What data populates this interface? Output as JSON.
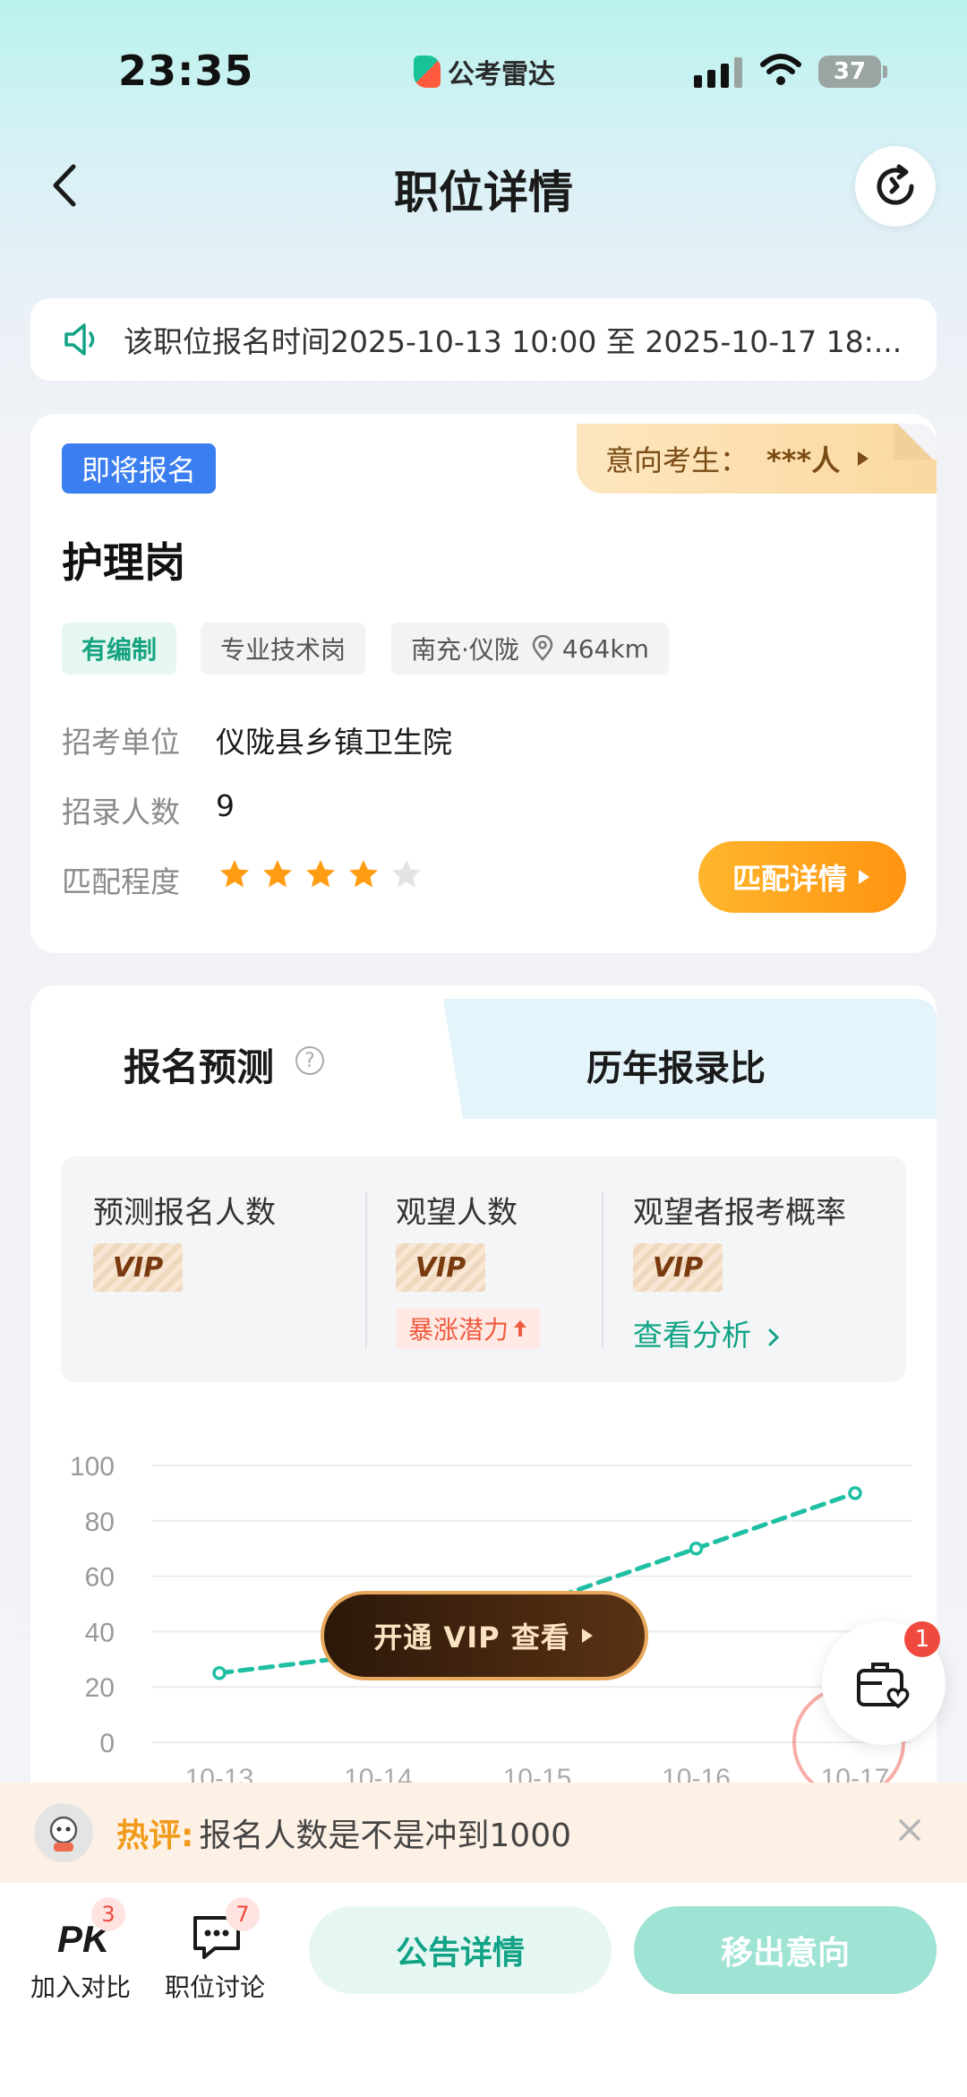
{
  "status_bar": {
    "time": "23:35",
    "app_brand": "公考雷达",
    "battery": "37"
  },
  "header": {
    "title": "职位详情"
  },
  "notice": {
    "text": "该职位报名时间2025-10-13 10:00 至 2025-10-17 18:..."
  },
  "job": {
    "status_badge": "即将报名",
    "intent_label": "意向考生：",
    "intent_value": "***人",
    "title": "护理岗",
    "tags": [
      "有编制",
      "专业技术岗"
    ],
    "location": "南充·仪陇",
    "distance": "464km",
    "fields": [
      {
        "label": "招考单位",
        "value": "仪陇县乡镇卫生院"
      },
      {
        "label": "招录人数",
        "value": "9"
      },
      {
        "label": "匹配程度",
        "value": ""
      }
    ],
    "match_stars": 4,
    "match_stars_max": 5,
    "match_button": "匹配详情"
  },
  "forecast": {
    "tabs": [
      "报名预测",
      "历年报录比"
    ],
    "active_tab": 0,
    "stats": [
      {
        "label": "预测报名人数",
        "value": "VIP"
      },
      {
        "label": "观望人数",
        "value": "VIP",
        "extra": "暴涨潜力"
      },
      {
        "label": "观望者报考概率",
        "value": "VIP",
        "link": "查看分析"
      }
    ],
    "vip_button": "开通 VIP 查看"
  },
  "chart_data": {
    "type": "line",
    "categories": [
      "10-13",
      "10-14",
      "10-15",
      "10-16",
      "10-17"
    ],
    "series": [
      {
        "values": [
          25,
          32,
          50,
          70,
          90
        ]
      }
    ],
    "ylim": [
      0,
      100
    ],
    "yticks": [
      "100",
      "80",
      "60",
      "40",
      "20",
      "0"
    ],
    "line_style": "dashed",
    "color": "#1fbfa3",
    "grid": true
  },
  "float_button": {
    "icon": "briefcase-heart-icon",
    "badge": "1"
  },
  "hot_comment": {
    "label": "热评:",
    "text": "报名人数是不是冲到1000"
  },
  "bottom_bar": {
    "compare_label": "加入对比",
    "compare_badge": "3",
    "discuss_label": "职位讨论",
    "discuss_badge": "7",
    "announcement_button": "公告详情",
    "remove_button": "移出意向"
  },
  "colors": {
    "accent": "#12a386",
    "primary_blue": "#3a7ef0",
    "orange": "#ff9410"
  }
}
